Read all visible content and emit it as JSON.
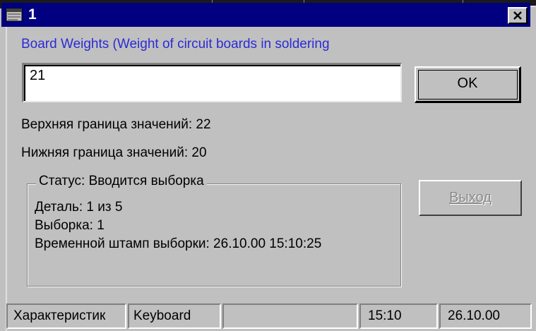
{
  "window": {
    "title": "1",
    "icon": "app-window-icon",
    "close_icon": "close-icon"
  },
  "prompt": {
    "text": "Board Weights (Weight of circuit boards in soldering"
  },
  "input": {
    "value": "21"
  },
  "buttons": {
    "ok_label": "OK",
    "exit_label": "Выход"
  },
  "limits": {
    "upper": "Верхняя граница значений: 22",
    "lower": "Нижняя граница значений: 20"
  },
  "status": {
    "legend": "Статус: Вводится выборка",
    "part": "Деталь: 1 из 5",
    "sample": "Выборка: 1",
    "timestamp": "Временной штамп выборки: 26.10.00 15:10:25"
  },
  "statusbar": {
    "panels": [
      "Характеристик",
      "Keyboard",
      "",
      "15:10",
      "26.10.00"
    ]
  },
  "colors": {
    "titlebar": "#000080",
    "prompt_text": "#2b2bd6",
    "face": "#c0c0c0"
  }
}
